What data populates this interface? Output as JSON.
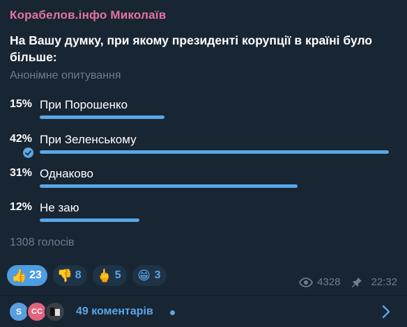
{
  "post": {
    "channel": "Корабелов.інфо Миколаїв",
    "question": "На Вашу думку, при якому президенті корупції в країні було більше:",
    "poll_type": "Анонімне опитування",
    "total_votes": "1308 голосів"
  },
  "options": [
    {
      "percent": "15%",
      "label": "При Порошенко",
      "value": 15,
      "chosen": false
    },
    {
      "percent": "42%",
      "label": "При Зеленському",
      "value": 42,
      "chosen": true
    },
    {
      "percent": "31%",
      "label": "Однаково",
      "value": 31,
      "chosen": false
    },
    {
      "percent": "12%",
      "label": "Не заю",
      "value": 12,
      "chosen": false
    }
  ],
  "reactions": [
    {
      "emoji": "👍",
      "count": "23",
      "active": true,
      "icon": "thumbs-up-icon"
    },
    {
      "emoji": "👎",
      "count": "8",
      "active": false,
      "icon": "thumbs-down-icon"
    },
    {
      "emoji": "🖕",
      "count": "5",
      "active": false,
      "icon": "middle-finger-icon"
    },
    {
      "emoji": "😁",
      "count": "3",
      "active": false,
      "icon": "grinning-face-icon"
    }
  ],
  "meta": {
    "views": "4328",
    "time": "22:32"
  },
  "comments": {
    "label": "49 коментарів",
    "avatars": [
      {
        "initials": "S",
        "color": "#5a9ee0"
      },
      {
        "initials": "CC",
        "color": "#e0647e"
      },
      {
        "initials": "",
        "color": "#3a3f46"
      }
    ]
  },
  "colors": {
    "accent": "#5aa7e6",
    "channel_name": "#e5739e",
    "background": "#182533"
  }
}
